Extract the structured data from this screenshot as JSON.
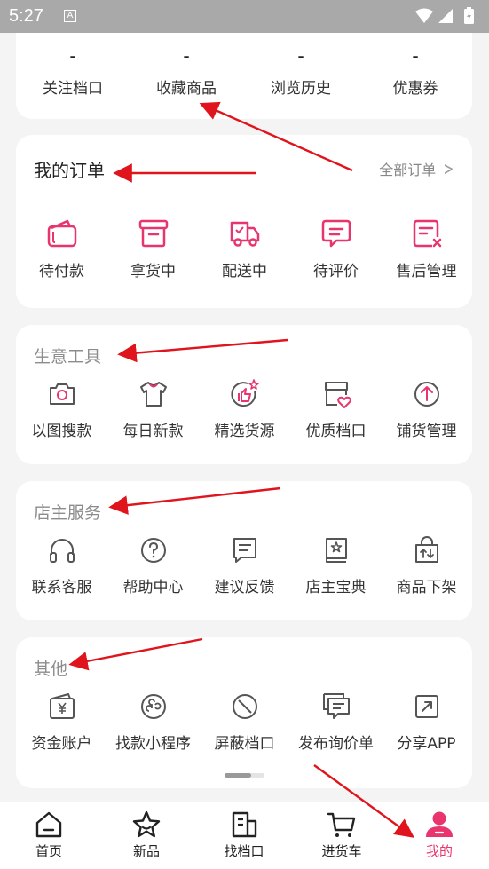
{
  "status_bar": {
    "time": "5:27",
    "badge": "A"
  },
  "stats": [
    {
      "value": "-",
      "label": "关注档口"
    },
    {
      "value": "-",
      "label": "收藏商品"
    },
    {
      "value": "-",
      "label": "浏览历史"
    },
    {
      "value": "-",
      "label": "优惠券"
    }
  ],
  "orders": {
    "title": "我的订单",
    "all_label": "全部订单",
    "items": [
      {
        "label": "待付款",
        "icon": "wallet-icon"
      },
      {
        "label": "拿货中",
        "icon": "box-icon"
      },
      {
        "label": "配送中",
        "icon": "truck-icon"
      },
      {
        "label": "待评价",
        "icon": "comment-icon"
      },
      {
        "label": "售后管理",
        "icon": "after-sales-icon"
      }
    ]
  },
  "business_tools": {
    "title": "生意工具",
    "items": [
      {
        "label": "以图搜款",
        "icon": "camera-icon"
      },
      {
        "label": "每日新款",
        "icon": "tshirt-icon"
      },
      {
        "label": "精选货源",
        "icon": "thumbs-up-icon"
      },
      {
        "label": "优质档口",
        "icon": "store-heart-icon"
      },
      {
        "label": "铺货管理",
        "icon": "upload-circle-icon"
      }
    ]
  },
  "owner_services": {
    "title": "店主服务",
    "items": [
      {
        "label": "联系客服",
        "icon": "headphones-icon"
      },
      {
        "label": "帮助中心",
        "icon": "help-icon"
      },
      {
        "label": "建议反馈",
        "icon": "feedback-icon"
      },
      {
        "label": "店主宝典",
        "icon": "book-icon"
      },
      {
        "label": "商品下架",
        "icon": "bag-arrows-icon"
      }
    ]
  },
  "others": {
    "title": "其他",
    "items": [
      {
        "label": "资金账户",
        "icon": "yuan-wallet-icon"
      },
      {
        "label": "找款小程序",
        "icon": "mini-program-icon"
      },
      {
        "label": "屏蔽档口",
        "icon": "block-icon"
      },
      {
        "label": "发布询价单",
        "icon": "inquiry-icon"
      },
      {
        "label": "分享APP",
        "icon": "share-icon"
      }
    ]
  },
  "tabs": [
    {
      "label": "首页",
      "icon": "home-icon"
    },
    {
      "label": "新品",
      "icon": "star-icon"
    },
    {
      "label": "找档口",
      "icon": "building-icon"
    },
    {
      "label": "进货车",
      "icon": "cart-icon"
    },
    {
      "label": "我的",
      "icon": "user-icon"
    }
  ],
  "colors": {
    "accent": "#e8356d",
    "annotation_red": "#e0141c",
    "status_bar": "#a9a9a9"
  }
}
